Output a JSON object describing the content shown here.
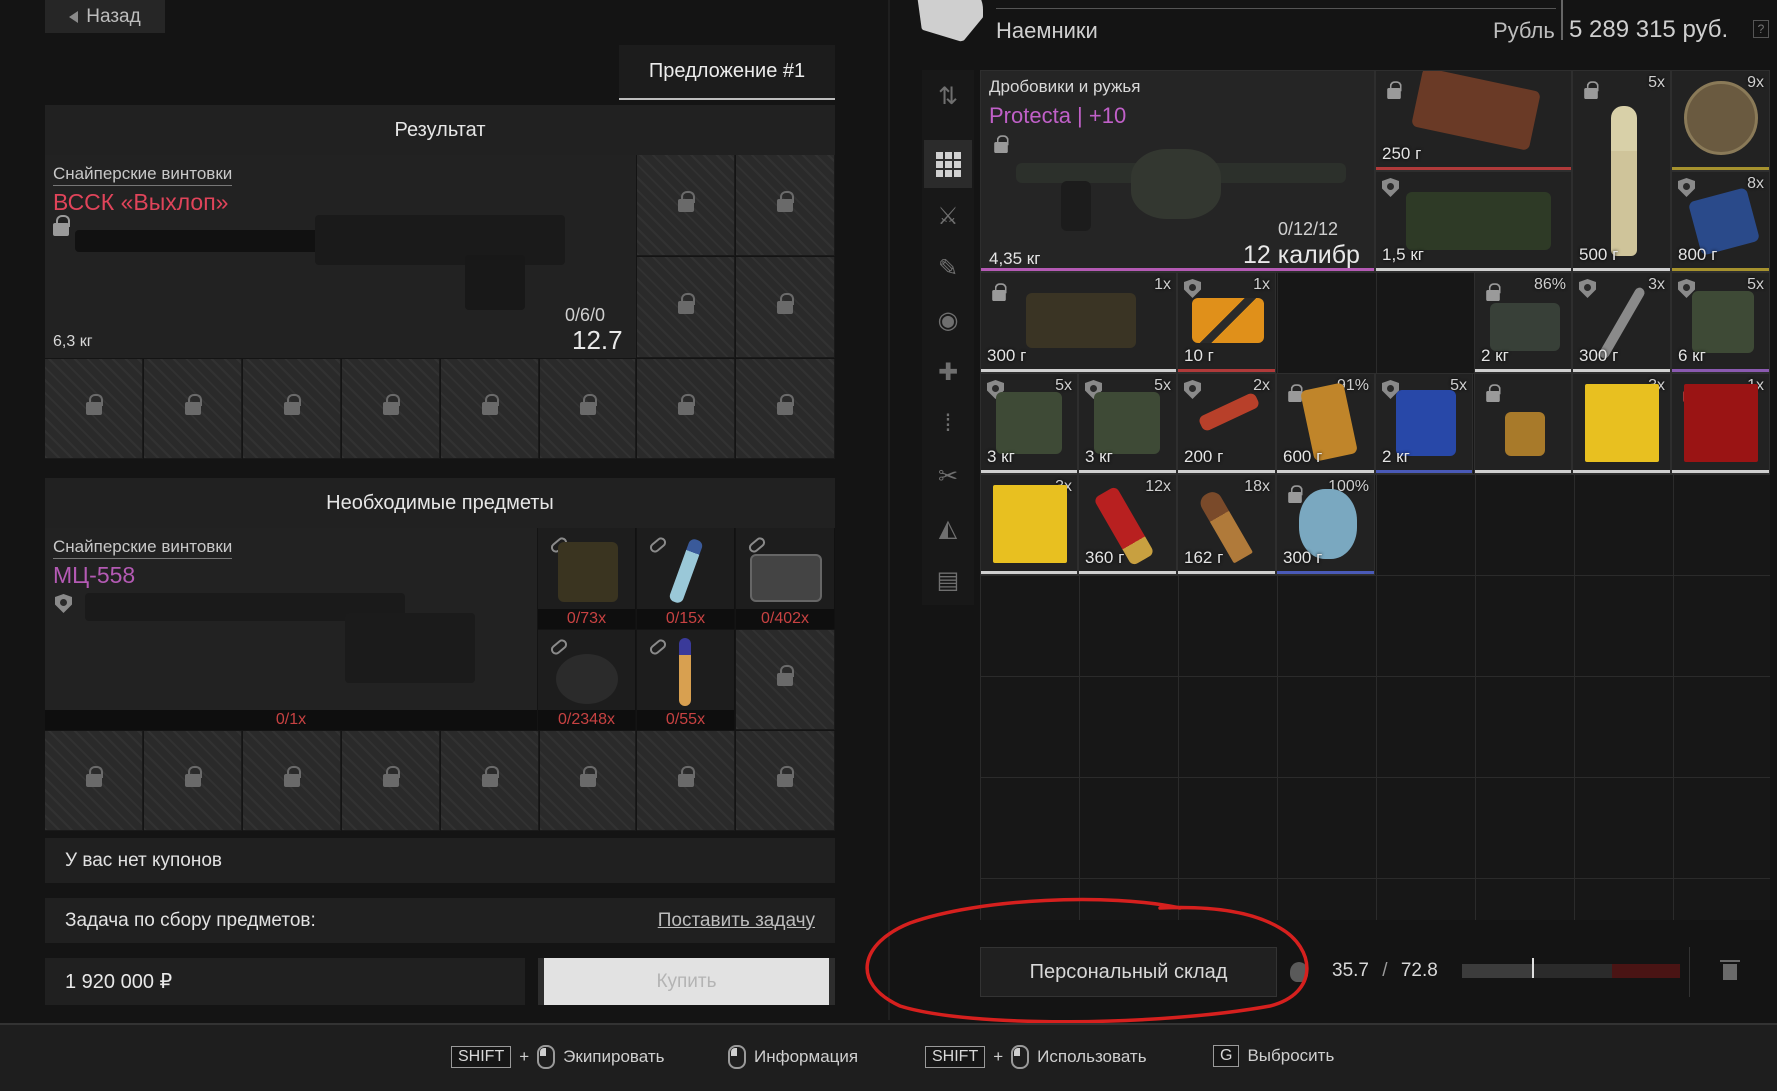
{
  "nav": {
    "back_label": "Назад"
  },
  "offer": {
    "tab_label": "Предложение #1"
  },
  "result": {
    "heading": "Результат",
    "category": "Снайперские винтовки",
    "name": "ВССК «Выхлоп»",
    "name_color": "#e0445a",
    "weight": "6,3 кг",
    "ammo": "0/6/0",
    "caliber": "12.7"
  },
  "required": {
    "heading": "Необходимые предметы",
    "category": "Снайперские винтовки",
    "name": "МЦ-558",
    "name_color": "#b45ab4",
    "main_count": "0/1x",
    "items": [
      {
        "count": "0/73x",
        "icon": "ammo-box-icon"
      },
      {
        "count": "0/15x",
        "icon": "blue-tip-cartridge-icon"
      },
      {
        "count": "0/402x",
        "icon": "grey-case-icon"
      },
      {
        "count": "0/2348x",
        "icon": "black-lumps-icon"
      },
      {
        "count": "0/55x",
        "icon": "orange-tip-cartridge-icon"
      }
    ]
  },
  "coupons": {
    "text": "У вас нет купонов"
  },
  "task": {
    "label": "Задача по сбору предметов:",
    "link": "Поставить задачу"
  },
  "purchase": {
    "price": "1 920 000 ₽",
    "buy_label": "Купить"
  },
  "trader": {
    "name": "Наемники",
    "currency_label": "Рубль",
    "money": "5 289 315 руб.",
    "help": "?"
  },
  "stash": {
    "featured": {
      "category": "Дробовики и ружья",
      "name": "Protecta | +10",
      "name_color": "#c060c8",
      "ammo": "0/12/12",
      "caliber": "12 калибр",
      "weight": "4,35 кг"
    },
    "items": [
      {
        "weight": "250 г",
        "qty": "",
        "icon": "leather-pouch-icon",
        "mark": "lock"
      },
      {
        "weight": "1,5 кг",
        "qty": "",
        "icon": "green-case-icon",
        "mark": "shield"
      },
      {
        "weight": "500 г",
        "qty": "5x",
        "icon": "champagne-bottle-icon",
        "mark": "lock"
      },
      {
        "weight": "",
        "qty": "9x",
        "icon": "bronze-medal-icon",
        "mark": ""
      },
      {
        "weight": "800 г",
        "qty": "8x",
        "icon": "blue-box-icon",
        "mark": "shield"
      },
      {
        "weight": "300 г",
        "qty": "1x",
        "icon": "ammo-crate-icon",
        "mark": "lock"
      },
      {
        "weight": "10 г",
        "qty": "1x",
        "icon": "orange-case-icon",
        "mark": "shield"
      },
      {
        "weight": "2 кг",
        "qty": "86%",
        "icon": "armor-plate-icon",
        "mark": "lock"
      },
      {
        "weight": "300 г",
        "qty": "3x",
        "icon": "knife-icon",
        "mark": "shield"
      },
      {
        "weight": "6 кг",
        "qty": "5x",
        "icon": "backpack-icon",
        "mark": "shield"
      },
      {
        "weight": "3 кг",
        "qty": "5x",
        "icon": "backpack-icon",
        "mark": "shield"
      },
      {
        "weight": "3 кг",
        "qty": "5x",
        "icon": "backpack-icon",
        "mark": "shield"
      },
      {
        "weight": "200 г",
        "qty": "2x",
        "icon": "flare-gun-icon",
        "mark": "shield"
      },
      {
        "weight": "600 г",
        "qty": "91%",
        "icon": "detector-icon",
        "mark": "lock"
      },
      {
        "weight": "2 кг",
        "qty": "5x",
        "icon": "medkit-icon",
        "mark": "shield"
      },
      {
        "weight": "",
        "qty": "",
        "icon": "keychain-icon",
        "mark": "lock"
      },
      {
        "weight": "",
        "qty": "3x",
        "icon": "yellow-document-icon",
        "mark": ""
      },
      {
        "weight": "",
        "qty": "1x",
        "icon": "red-document-icon",
        "mark": "lock"
      },
      {
        "weight": "",
        "qty": "3x",
        "icon": "yellow-document-icon",
        "mark": ""
      },
      {
        "weight": "360 г",
        "qty": "12x",
        "icon": "shotgun-shell-icon",
        "mark": ""
      },
      {
        "weight": "162 г",
        "qty": "18x",
        "icon": "bullet-icon",
        "mark": ""
      },
      {
        "weight": "300 г",
        "qty": "100%",
        "icon": "crystal-artifact-icon",
        "mark": "lock"
      }
    ]
  },
  "storage": {
    "button_label": "Персональный склад",
    "weight_current": "35.7",
    "weight_sep": "/",
    "weight_max": "72.8"
  },
  "hints": [
    {
      "key": "SHIFT",
      "plus": "+",
      "label": "Экипировать"
    },
    {
      "key": "",
      "plus": "",
      "label": "Информация"
    },
    {
      "key": "SHIFT",
      "plus": "+",
      "label": "Использовать"
    },
    {
      "key": "G",
      "plus": "",
      "label": "Выбросить"
    }
  ],
  "colors": {
    "annotation": "#d6201e",
    "accent_red": "#c84242"
  }
}
